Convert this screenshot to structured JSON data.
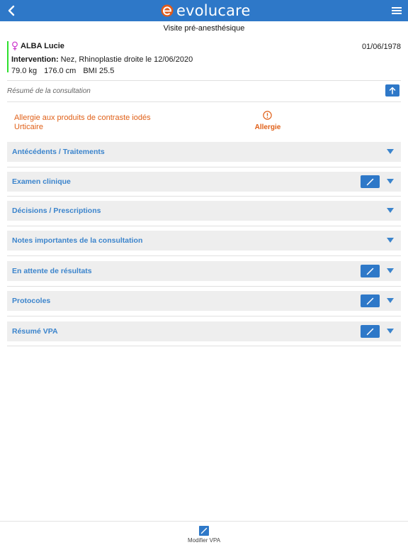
{
  "header": {
    "logo_text": "evolucare",
    "subtitle": "Visite pré-anesthésique"
  },
  "patient": {
    "name": "ALBA Lucie",
    "dob": "01/06/1978",
    "intervention_label": "Intervention:",
    "intervention_value": " Nez, Rhinoplastie droite le 12/06/2020",
    "weight": "79.0 kg",
    "height": "176.0 cm",
    "bmi": "BMI 25.5"
  },
  "summary": {
    "label": "Résumé de la consultation"
  },
  "allergy": {
    "line1": "Allergie aux produits de contraste iodés",
    "line2": "Urticaire",
    "label": "Allergie"
  },
  "sections": [
    {
      "title": "Antécédents / Traitements",
      "editable": false
    },
    {
      "title": "Examen clinique",
      "editable": true
    },
    {
      "title": "Décisions / Prescriptions",
      "editable": false
    },
    {
      "title": "Notes importantes de la consultation",
      "editable": false
    },
    {
      "title": "En attente de résultats",
      "editable": true
    },
    {
      "title": "Protocoles",
      "editable": true
    },
    {
      "title": "Résumé VPA",
      "editable": true
    }
  ],
  "footer": {
    "modify_label": "Modifier VPA"
  },
  "colors": {
    "primary": "#2e78c8",
    "section_title": "#3b84cc",
    "allergy": "#e06018",
    "patient_bar": "#2ee02e",
    "gender_icon": "#cc33cc"
  },
  "icons": {
    "back": "back-icon",
    "menu": "hamburger-menu-icon",
    "gender": "female-icon",
    "upload": "arrow-up-icon",
    "warning": "exclamation-circle-icon",
    "edit": "pencil-icon",
    "expand": "caret-down-icon"
  }
}
